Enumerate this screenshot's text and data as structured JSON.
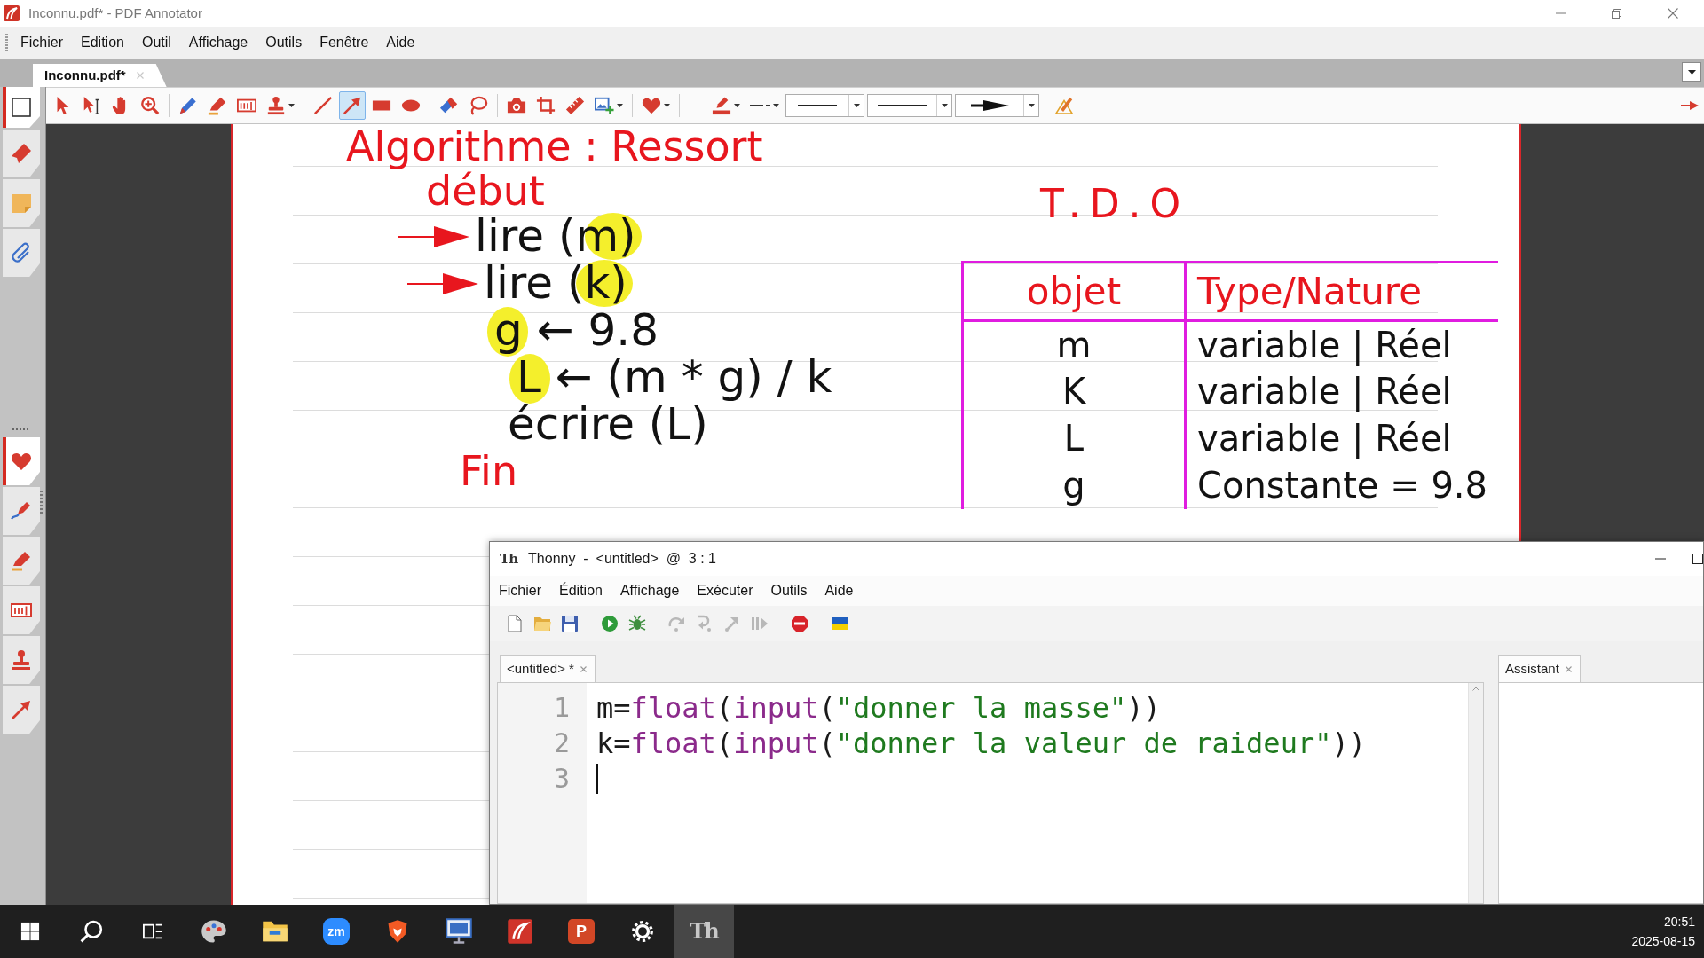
{
  "window": {
    "title": "Inconnu.pdf* - PDF Annotator"
  },
  "menu": [
    "Fichier",
    "Edition",
    "Outil",
    "Affichage",
    "Outils",
    "Fenêtre",
    "Aide"
  ],
  "document_tabs": [
    {
      "label": "Inconnu.pdf*",
      "selected": true
    }
  ],
  "sidebar": {
    "top_items": [
      {
        "kind": "pages",
        "selected": true
      },
      {
        "kind": "bookmarks",
        "selected": false
      },
      {
        "kind": "notes",
        "selected": false
      },
      {
        "kind": "attachments",
        "selected": false
      }
    ],
    "bottom_items": [
      {
        "kind": "favorites",
        "selected": true
      },
      {
        "kind": "pen",
        "selected": false
      },
      {
        "kind": "highlighter",
        "selected": false
      },
      {
        "kind": "text",
        "selected": false
      },
      {
        "kind": "stamp",
        "selected": false
      },
      {
        "kind": "arrow",
        "selected": false
      }
    ]
  },
  "toolbar": [
    [
      {
        "kind": "pointer",
        "selected": false,
        "dropdown": false
      },
      {
        "kind": "text-pointer",
        "selected": false,
        "dropdown": false
      },
      {
        "kind": "hand",
        "selected": false,
        "dropdown": false
      },
      {
        "kind": "zoom",
        "selected": false,
        "dropdown": false
      }
    ],
    [
      {
        "kind": "pen",
        "selected": false,
        "dropdown": false
      },
      {
        "kind": "highlighter",
        "selected": false,
        "dropdown": false
      },
      {
        "kind": "text",
        "selected": false,
        "dropdown": false
      },
      {
        "kind": "stamp",
        "selected": false,
        "dropdown": true
      }
    ],
    [
      {
        "kind": "line",
        "selected": false,
        "dropdown": false
      },
      {
        "kind": "arrow",
        "selected": true,
        "dropdown": false
      },
      {
        "kind": "rectangle",
        "selected": false,
        "dropdown": false
      },
      {
        "kind": "ellipse",
        "selected": false,
        "dropdown": false
      }
    ],
    [
      {
        "kind": "eraser",
        "selected": false,
        "dropdown": false
      },
      {
        "kind": "lasso",
        "selected": false,
        "dropdown": false
      }
    ],
    [
      {
        "kind": "camera",
        "selected": false,
        "dropdown": false
      },
      {
        "kind": "crop",
        "selected": false,
        "dropdown": false
      },
      {
        "kind": "ruler",
        "selected": false,
        "dropdown": false
      },
      {
        "kind": "image",
        "selected": false,
        "dropdown": true
      }
    ],
    [
      {
        "kind": "favorites",
        "selected": false,
        "dropdown": true
      }
    ],
    [
      {
        "kind": "line-color",
        "selected": false,
        "dropdown": true
      },
      {
        "kind": "dash",
        "selected": false,
        "dropdown": true
      },
      {
        "kind": "width-combo",
        "selected": false,
        "dropdown": true
      },
      {
        "kind": "style-combo",
        "selected": false,
        "dropdown": true
      },
      {
        "kind": "arrowhead-combo",
        "selected": false,
        "dropdown": true
      }
    ],
    [
      {
        "kind": "pencil",
        "selected": false,
        "dropdown": false
      }
    ]
  ],
  "page": {
    "algorithm": {
      "title": "Algorithme : Ressort",
      "begin": "début",
      "statements": [
        {
          "text": "lire (m)",
          "arrow": true,
          "highlight_start": false,
          "highlight_end": true
        },
        {
          "text": "lire (k)",
          "arrow": true,
          "highlight_start": false,
          "highlight_end": true
        },
        {
          "text": "g ← 9.8",
          "arrow": false,
          "highlight_start": true,
          "highlight_end": false
        },
        {
          "text": "L ← (m * g) / k",
          "arrow": false,
          "highlight_start": true,
          "highlight_end": false
        },
        {
          "text": "écrire (L)",
          "arrow": false,
          "highlight_start": false,
          "highlight_end": false
        }
      ],
      "end": "Fin"
    },
    "tdo": {
      "title": "T.D.O",
      "columns": [
        "objet",
        "Type/Nature"
      ],
      "rows": [
        [
          "m",
          "variable | Réel"
        ],
        [
          "K",
          "variable | Réel"
        ],
        [
          "L",
          "variable | Réel"
        ],
        [
          "g",
          "Constante = 9.8"
        ]
      ]
    }
  },
  "thonny": {
    "logo": "Th",
    "title": "Thonny  -  <untitled>  @  3 : 1",
    "menu": [
      "Fichier",
      "Édition",
      "Affichage",
      "Exécuter",
      "Outils",
      "Aide"
    ],
    "toolbar": [
      [
        {
          "kind": "new",
          "disabled": false
        },
        {
          "kind": "open",
          "disabled": false
        },
        {
          "kind": "save",
          "disabled": false
        }
      ],
      [
        {
          "kind": "run",
          "disabled": false
        },
        {
          "kind": "debug",
          "disabled": false
        }
      ],
      [
        {
          "kind": "step-over",
          "disabled": true
        },
        {
          "kind": "step-into",
          "disabled": true
        },
        {
          "kind": "step-out",
          "disabled": true
        },
        {
          "kind": "resume",
          "disabled": true
        }
      ],
      [
        {
          "kind": "stop",
          "disabled": false
        }
      ],
      [
        {
          "kind": "flag",
          "disabled": false
        }
      ]
    ],
    "editor_tabs": [
      {
        "label": "<untitled> *",
        "selected": true
      }
    ],
    "code_lines": [
      {
        "number": "1",
        "cursor": false,
        "tokens": [
          {
            "kind": "name",
            "text": "m="
          },
          {
            "kind": "builtin",
            "text": "float"
          },
          {
            "kind": "punct",
            "text": "("
          },
          {
            "kind": "builtin",
            "text": "input"
          },
          {
            "kind": "punct",
            "text": "("
          },
          {
            "kind": "string",
            "text": "\"donner la masse\""
          },
          {
            "kind": "punct",
            "text": "))"
          }
        ]
      },
      {
        "number": "2",
        "cursor": false,
        "tokens": [
          {
            "kind": "name",
            "text": "k="
          },
          {
            "kind": "builtin",
            "text": "float"
          },
          {
            "kind": "punct",
            "text": "("
          },
          {
            "kind": "builtin",
            "text": "input"
          },
          {
            "kind": "punct",
            "text": "("
          },
          {
            "kind": "string",
            "text": "\"donner la valeur de raideur\""
          },
          {
            "kind": "punct",
            "text": "))"
          }
        ]
      },
      {
        "number": "3",
        "cursor": true
      }
    ],
    "side_tabs": [
      {
        "label": "Assistant",
        "selected": true
      }
    ]
  },
  "taskbar": {
    "items": [
      {
        "kind": "start",
        "selected": false
      },
      {
        "kind": "search",
        "selected": false
      },
      {
        "kind": "task-view",
        "selected": false
      },
      {
        "kind": "palette",
        "selected": false
      },
      {
        "kind": "file-explorer",
        "selected": false
      },
      {
        "kind": "meeting",
        "label": "zm",
        "selected": false
      },
      {
        "kind": "browser",
        "selected": false
      },
      {
        "kind": "remote-desktop",
        "selected": false
      },
      {
        "kind": "annotator",
        "selected": false
      },
      {
        "kind": "presentation",
        "label": "P",
        "selected": false
      },
      {
        "kind": "settings",
        "selected": false
      },
      {
        "kind": "python-ide",
        "label": "Th",
        "selected": true
      }
    ],
    "time": "20:51",
    "date": "2025-08-15"
  }
}
